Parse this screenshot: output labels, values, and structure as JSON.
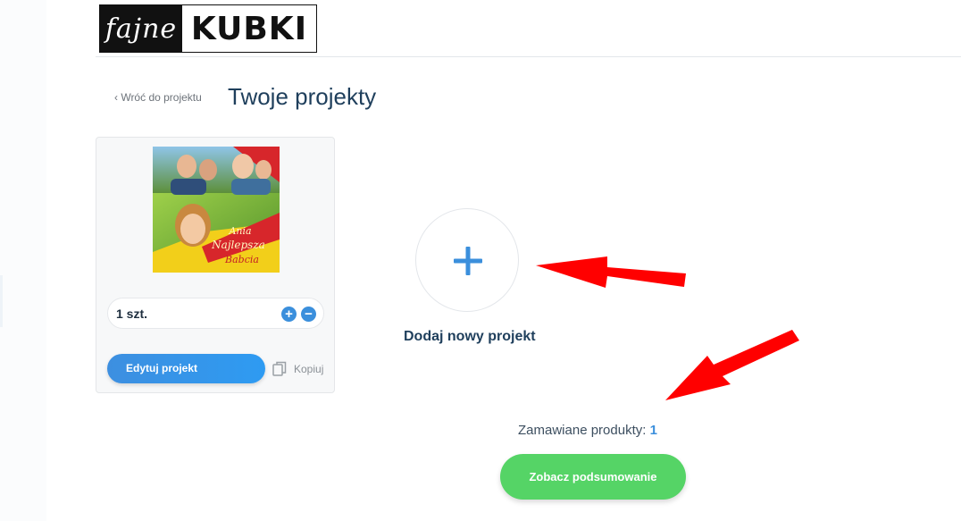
{
  "logo": {
    "left_text": "fajne",
    "right_text": "KUBKI"
  },
  "nav": {
    "back_link": "‹ Wróć do projektu"
  },
  "page": {
    "title": "Twoje projekty"
  },
  "project_card": {
    "image_name": "mug-design-photo-collage",
    "image_text": [
      "Ania",
      "Najlepsza",
      "Babcia"
    ],
    "quantity_label": "1 szt.",
    "edit_button": "Edytuj projekt",
    "copy_label": "Kopiuj"
  },
  "add_project": {
    "label": "Dodaj nowy projekt",
    "icon": "plus-icon"
  },
  "summary": {
    "ordered_label": "Zamawiane produkty:",
    "ordered_count": "1",
    "summary_button": "Zobacz podsumowanie"
  },
  "colors": {
    "accent_blue": "#3b8fdc",
    "title_navy": "#1f3f5c",
    "summary_green": "#55d466",
    "annotation_red": "#ff0000"
  }
}
